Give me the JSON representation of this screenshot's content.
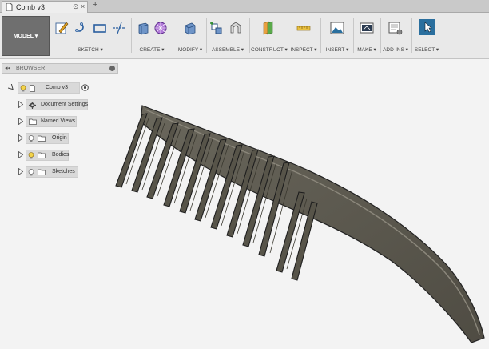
{
  "tab": {
    "title": "Comb v3"
  },
  "toolbar": {
    "model_label": "MODEL ▾",
    "groups": [
      {
        "label": "SKETCH ▾"
      },
      {
        "label": "CREATE ▾"
      },
      {
        "label": "MODIFY ▾"
      },
      {
        "label": "ASSEMBLE ▾"
      },
      {
        "label": "CONSTRUCT ▾"
      },
      {
        "label": "INSPECT ▾"
      },
      {
        "label": "INSERT ▾"
      },
      {
        "label": "MAKE ▾"
      },
      {
        "label": "ADD-INS ▾"
      },
      {
        "label": "SELECT ▾"
      }
    ]
  },
  "browser": {
    "title": "BROWSER",
    "root": "Comb v3",
    "items": [
      {
        "label": "Document Settings"
      },
      {
        "label": "Named Views"
      },
      {
        "label": "Origin"
      },
      {
        "label": "Bodies"
      },
      {
        "label": "Sketches"
      }
    ]
  },
  "colors": {
    "accent": "#2a6f9e",
    "model_body": "#5a574d"
  }
}
